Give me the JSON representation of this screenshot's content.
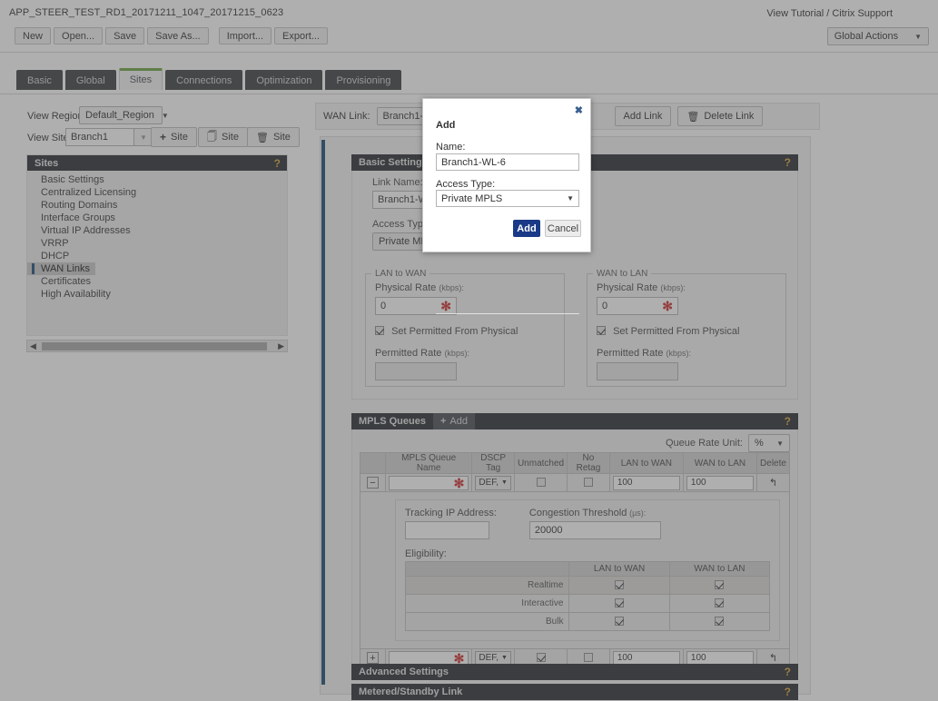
{
  "header": {
    "document_title": "APP_STEER_TEST_RD1_20171211_1047_20171215_0623",
    "links": "View Tutorial / Citrix Support",
    "file_buttons": [
      "New",
      "Open...",
      "Save",
      "Save As..."
    ],
    "io_buttons": [
      "Import...",
      "Export..."
    ],
    "global_actions": "Global Actions",
    "global_actions_caret": "▼"
  },
  "tabs": [
    {
      "label": "Basic",
      "active": false
    },
    {
      "label": "Global",
      "active": false
    },
    {
      "label": "Sites",
      "active": true
    },
    {
      "label": "Connections",
      "active": false
    },
    {
      "label": "Optimization",
      "active": false
    },
    {
      "label": "Provisioning",
      "active": false
    }
  ],
  "sidebar": {
    "view_region_label": "View Region:",
    "view_region_value": "Default_Region",
    "view_site_label": "View Site:",
    "view_site_value": "Branch1",
    "add_site_button": "Site",
    "copy_site_button": "Site",
    "delete_site_button": "Site",
    "tree_title": "Sites",
    "help": "?",
    "items": [
      {
        "label": "Basic Settings",
        "selected": false
      },
      {
        "label": "Centralized Licensing",
        "selected": false
      },
      {
        "label": "Routing Domains",
        "selected": false
      },
      {
        "label": "Interface Groups",
        "selected": false
      },
      {
        "label": "Virtual IP Addresses",
        "selected": false
      },
      {
        "label": "VRRP",
        "selected": false
      },
      {
        "label": "DHCP",
        "selected": false
      },
      {
        "label": "WAN Links",
        "selected": true
      },
      {
        "label": "Certificates",
        "selected": false
      },
      {
        "label": "High Availability",
        "selected": false
      }
    ]
  },
  "wan_toolbar": {
    "label": "WAN Link:",
    "selected_link": "Branch1-WL-5",
    "add_link": "Add Link",
    "delete_link": "Delete Link"
  },
  "basic_settings": {
    "title": "Basic Settings",
    "help": "?",
    "link_name_label": "Link Name:",
    "link_name_value": "Branch1-WL-5",
    "access_type_label": "Access Type:",
    "access_type_value": "Private MPLS",
    "lan_to_wan": {
      "legend": "LAN to WAN",
      "physical_rate_label": "Physical Rate",
      "physical_rate_unit": "(kbps):",
      "physical_rate_value": "0",
      "required_marker": "✻",
      "set_permitted_label": "Set Permitted From Physical",
      "set_permitted_checked": true,
      "permitted_rate_label": "Permitted Rate",
      "permitted_rate_unit": "(kbps):",
      "permitted_rate_value": ""
    },
    "wan_to_lan": {
      "legend": "WAN to LAN",
      "physical_rate_label": "Physical Rate",
      "physical_rate_unit": "(kbps):",
      "physical_rate_value": "0",
      "required_marker": "✻",
      "set_permitted_label": "Set Permitted From Physical",
      "set_permitted_checked": true,
      "permitted_rate_label": "Permitted Rate",
      "permitted_rate_unit": "(kbps):",
      "permitted_rate_value": ""
    }
  },
  "mpls_queues": {
    "title": "MPLS Queues",
    "add_label": "Add",
    "help": "?",
    "queue_rate_unit_label": "Queue Rate Unit:",
    "queue_rate_unit_value": "%",
    "columns": [
      "",
      "MPLS Queue Name",
      "DSCP Tag",
      "Unmatched",
      "No Retag",
      "LAN to WAN",
      "WAN to LAN",
      "Delete"
    ],
    "rows": [
      {
        "expander": "−",
        "name": "",
        "required_marker": "✻",
        "dscp": "DEF,",
        "unmatched": false,
        "no_retag": false,
        "lan_to_wan": "100",
        "wan_to_lan": "100",
        "delete_icon": "undo-arrow"
      },
      {
        "expander": "+",
        "name": "",
        "required_marker": "✻",
        "dscp": "DEF,",
        "unmatched": true,
        "no_retag": false,
        "lan_to_wan": "100",
        "wan_to_lan": "100",
        "delete_icon": "undo-arrow"
      }
    ],
    "detail": {
      "tracking_ip_label": "Tracking IP Address:",
      "tracking_ip_value": "",
      "congestion_label": "Congestion Threshold",
      "congestion_unit": "(µs):",
      "congestion_value": "20000",
      "eligibility_label": "Eligibility:",
      "eligibility_columns": [
        "",
        "LAN to WAN",
        "WAN to LAN"
      ],
      "eligibility_rows": [
        {
          "name": "Realtime",
          "lan_to_wan": true,
          "wan_to_lan": true
        },
        {
          "name": "Interactive",
          "lan_to_wan": true,
          "wan_to_lan": true
        },
        {
          "name": "Bulk",
          "lan_to_wan": true,
          "wan_to_lan": true
        }
      ]
    }
  },
  "collapsed_panels": [
    {
      "title": "Advanced Settings",
      "help": "?"
    },
    {
      "title": "Metered/Standby Link",
      "help": "?"
    }
  ],
  "modal": {
    "title": "Add",
    "close": "✖",
    "name_label": "Name:",
    "name_value": "Branch1-WL-6",
    "access_type_label": "Access Type:",
    "access_type_value": "Private MPLS",
    "access_type_caret": "▼",
    "add_button": "Add",
    "cancel_button": "Cancel"
  },
  "colors": {
    "accent_green": "#6aa53f",
    "panel_header": "#292d33",
    "help_orange": "#d9a441",
    "required_red": "#cf2b2b",
    "primary_blue": "#1a3a87",
    "side_accent_blue": "#1b4d73"
  }
}
